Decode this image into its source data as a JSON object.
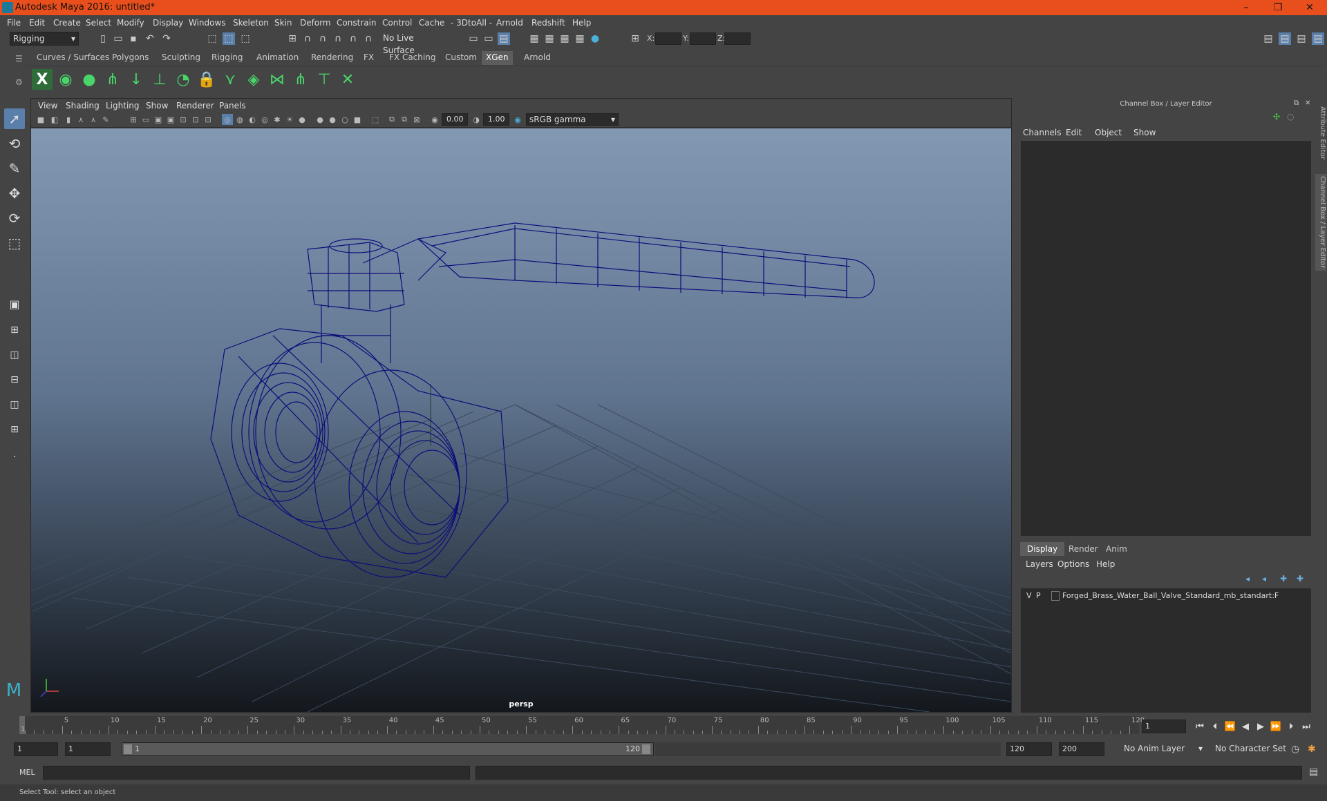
{
  "window": {
    "title": "Autodesk Maya 2016: untitled*",
    "controls": [
      "–",
      "❐",
      "✕"
    ]
  },
  "menubar": [
    "File",
    "Edit",
    "Create",
    "Select",
    "Modify",
    "Display",
    "Windows",
    "Skeleton",
    "Skin",
    "Deform",
    "Constrain",
    "Control",
    "Cache",
    "- 3DtoAll -",
    "Arnold",
    "Redshift",
    "Help"
  ],
  "statusline": {
    "menuset": "Rigging",
    "live_surface": "No Live Surface",
    "x_label": "X:",
    "y_label": "Y:",
    "z_label": "Z:"
  },
  "shelf": {
    "tabs": [
      "Curves / Surfaces",
      "Polygons",
      "Sculpting",
      "Rigging",
      "Animation",
      "Rendering",
      "FX",
      "FX Caching",
      "Custom",
      "XGen",
      "Arnold"
    ],
    "active_tab": "XGen",
    "icons": [
      "xgen-editor",
      "preview",
      "create-description",
      "guides",
      "add-guide",
      "place-guide",
      "sculpt-guide",
      "lock",
      "grass",
      "layer",
      "comb",
      "density",
      "cut",
      "delete"
    ]
  },
  "viewport": {
    "menus": [
      "View",
      "Shading",
      "Lighting",
      "Show",
      "Renderer",
      "Panels"
    ],
    "exposure": "0.00",
    "gamma": "1.00",
    "colorspace": "sRGB gamma",
    "camera": "persp"
  },
  "channel_box": {
    "title": "Channel Box / Layer Editor",
    "menus": [
      "Channels",
      "Edit",
      "Object",
      "Show"
    ],
    "layer_tabs": [
      "Display",
      "Render",
      "Anim"
    ],
    "active_layer_tab": "Display",
    "layer_menus": [
      "Layers",
      "Options",
      "Help"
    ],
    "layers": [
      {
        "v": "V",
        "p": "P",
        "name": "Forged_Brass_Water_Ball_Valve_Standard_mb_standart:F"
      }
    ]
  },
  "side_tabs": [
    "Attribute Editor",
    "Channel Box / Layer Editor"
  ],
  "timeline": {
    "start": 1,
    "end": 120,
    "ticks": [
      5,
      10,
      15,
      20,
      25,
      30,
      35,
      40,
      45,
      50,
      55,
      60,
      65,
      70,
      75,
      80,
      85,
      90,
      95,
      100,
      105,
      110,
      115,
      120
    ],
    "current_frame": "1"
  },
  "range": {
    "start": "1",
    "playback_start": "1",
    "slider_start": "1",
    "slider_end": "120",
    "playback_end": "120",
    "end": "200",
    "anim_layer": "No Anim Layer",
    "character_set": "No Character Set"
  },
  "command_line": {
    "label": "MEL"
  },
  "help_line": "Select Tool: select an object",
  "colors": {
    "title_bar": "#e84f1c",
    "wireframe": "#0d0d7a",
    "active_tool": "#5a7faa"
  }
}
